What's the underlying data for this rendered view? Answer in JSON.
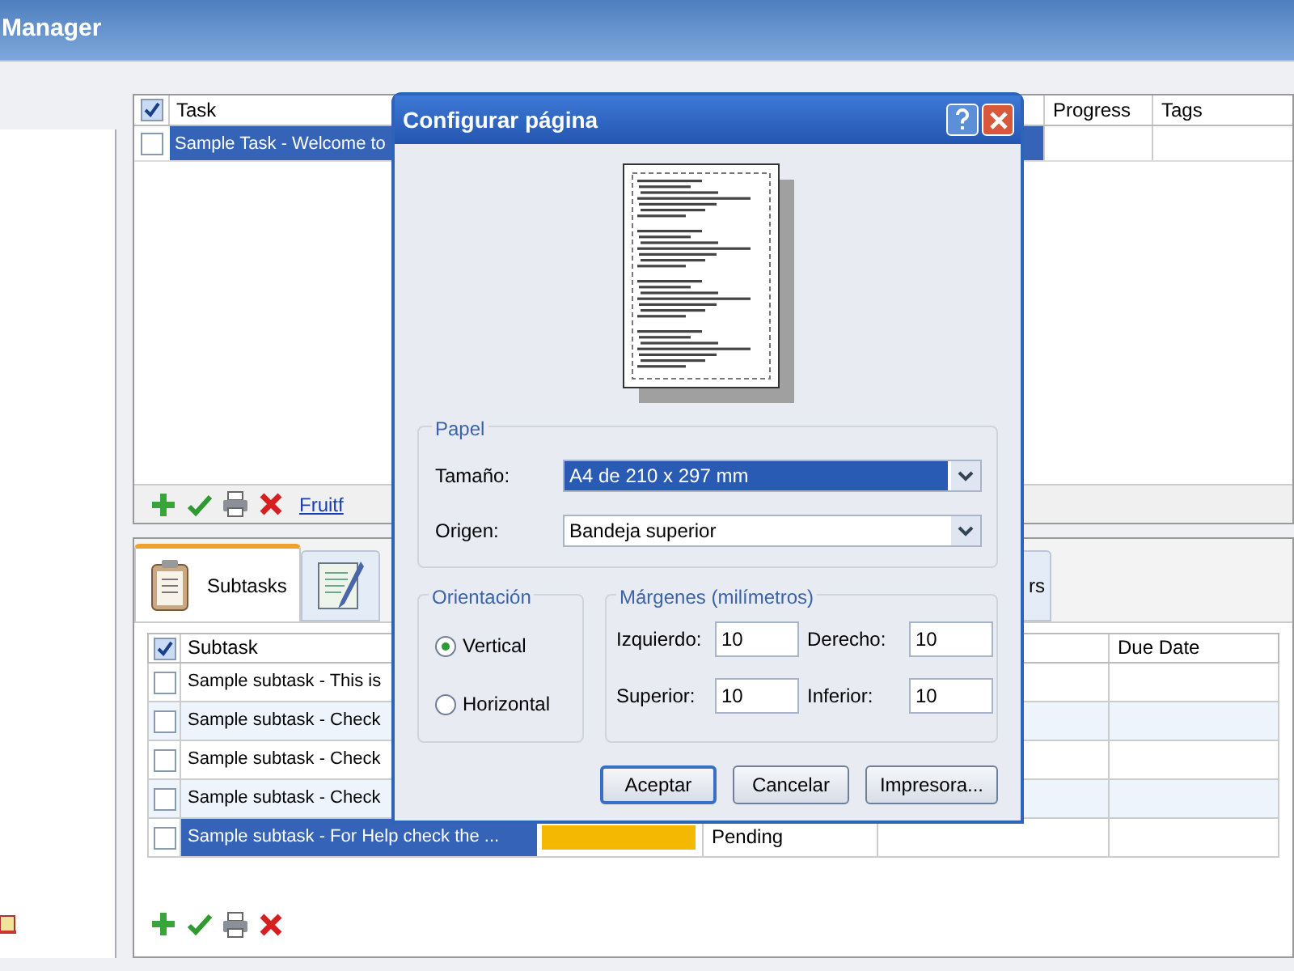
{
  "window": {
    "title": "Manager"
  },
  "tasks": {
    "header_checked": true,
    "columns": [
      "Task",
      "Progress",
      "Tags"
    ],
    "rows": [
      {
        "task": "Sample Task - Welcome to",
        "checked": false,
        "selected": true
      }
    ],
    "toolbar_link": "Fruitf"
  },
  "detail_tabs": [
    {
      "label": "Subtasks",
      "kind": "clipboard",
      "selected": true
    },
    {
      "kind": "notepad",
      "selected": false
    },
    {
      "label": "rs",
      "kind": "plain",
      "selected": false
    }
  ],
  "subtasks": {
    "header_checked": true,
    "columns": [
      "Subtask",
      "Due Date"
    ],
    "rows": [
      {
        "subtask": "Sample subtask - This is",
        "checked": false,
        "selected": false
      },
      {
        "subtask": "Sample subtask - Check",
        "checked": false,
        "selected": false
      },
      {
        "subtask": "Sample subtask - Check",
        "checked": false,
        "selected": false
      },
      {
        "subtask": "Sample subtask - Check",
        "checked": false,
        "selected": false
      },
      {
        "subtask": "Sample subtask - For Help check the ...",
        "checked": false,
        "selected": true,
        "color": "#f5b800",
        "status": "Pending"
      }
    ]
  },
  "dialog": {
    "title": "Configurar página",
    "paper": {
      "title": "Papel",
      "size_label": "Tamaño:",
      "size_value": "A4 de 210 x 297 mm",
      "source_label": "Origen:",
      "source_value": "Bandeja superior"
    },
    "orientation": {
      "title": "Orientación",
      "options": [
        {
          "label": "Vertical",
          "selected": true
        },
        {
          "label": "Horizontal",
          "selected": false
        }
      ]
    },
    "margins": {
      "title": "Márgenes (milímetros)",
      "fields": [
        {
          "label": "Izquierdo:",
          "value": "10"
        },
        {
          "label": "Derecho:",
          "value": "10"
        },
        {
          "label": "Superior:",
          "value": "10"
        },
        {
          "label": "Inferior:",
          "value": "10"
        }
      ]
    },
    "buttons": [
      {
        "label": "Aceptar",
        "default": true
      },
      {
        "label": "Cancelar",
        "default": false
      },
      {
        "label": "Impresora...",
        "default": false
      }
    ]
  }
}
